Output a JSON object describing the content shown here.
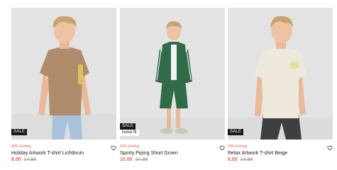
{
  "products": [
    {
      "discount": "60% Korting",
      "name": "Holiday Artwork T-shirt Lichtbruin",
      "price": "6.00",
      "old_price": "14.99",
      "badge": "SALE",
      "fit_label": ""
    },
    {
      "discount": "60% Korting",
      "name": "Sporty Piping Short Groen",
      "price": "10.00",
      "old_price": "24.99",
      "badge": "SALE",
      "fit_label": "loose fit"
    },
    {
      "discount": "60% Korting",
      "name": "Relax Artwork T-shirt Beige",
      "price": "6.00",
      "old_price": "14.99",
      "badge": "SALE",
      "fit_label": ""
    }
  ],
  "colors": {
    "accent": "#e35f4f",
    "text": "#1a1a1a",
    "muted": "#9a9a9a",
    "photo_bg": "#e2e2e2",
    "badge_bg": "#1a1a1a"
  },
  "icons": {
    "favorite": "heart-outline-icon"
  }
}
